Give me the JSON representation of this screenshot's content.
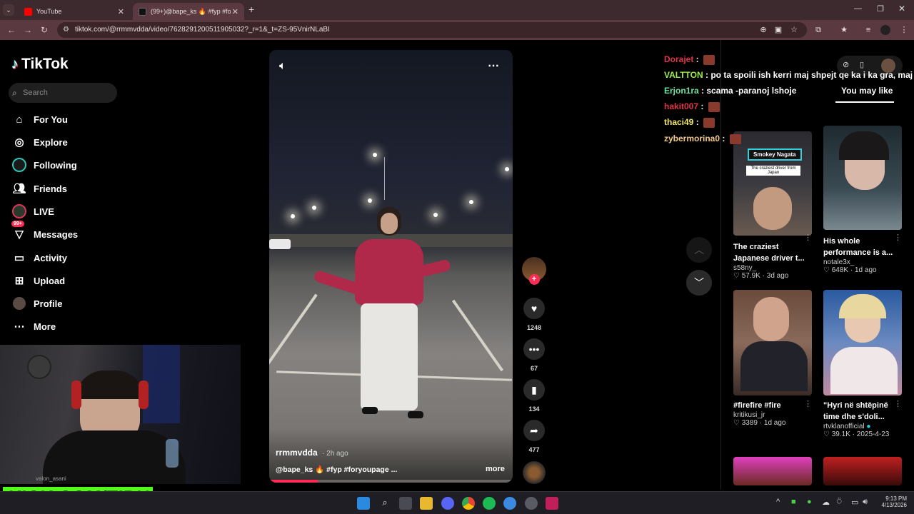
{
  "browser": {
    "tabs": [
      {
        "label": "YouTube",
        "icon": "youtube-icon"
      },
      {
        "label": "(99+)@bape_ks 🔥 #fyp #foryo",
        "icon": "tiktok-icon"
      }
    ],
    "new_tab": "+",
    "url": "tiktok.com/@rrmmvdda/video/7628291200511905032?_r=1&_t=ZS-95VnirNLaBI"
  },
  "sidebar": {
    "logo": "TikTok",
    "search_placeholder": "Search",
    "items": [
      {
        "label": "For You",
        "icon": "home-icon"
      },
      {
        "label": "Explore",
        "icon": "compass-icon"
      },
      {
        "label": "Following",
        "icon": "following-avatar-icon"
      },
      {
        "label": "Friends",
        "icon": "friends-icon"
      },
      {
        "label": "LIVE",
        "icon": "live-icon"
      },
      {
        "label": "Messages",
        "icon": "messages-icon",
        "badge": "99+"
      },
      {
        "label": "Activity",
        "icon": "activity-icon"
      },
      {
        "label": "Upload",
        "icon": "upload-icon"
      },
      {
        "label": "Profile",
        "icon": "profile-avatar-icon"
      },
      {
        "label": "More",
        "icon": "more-icon"
      }
    ]
  },
  "stream": {
    "webcam_caption": "valon_asani",
    "kick": "KICK.COM/TIBU"
  },
  "video": {
    "author": "rrmmvdda",
    "time": "· 2h ago",
    "caption": "@bape_ks 🔥 #fyp #foryoupage ...",
    "more": "more",
    "progress": 0.2
  },
  "actions": {
    "likes": "1248",
    "comments": "67",
    "saves": "134",
    "shares": "477"
  },
  "chat": [
    {
      "user": "Dorajet",
      "color": "#e0344a",
      "text": ""
    },
    {
      "user": "VALTTON",
      "color": "#9cf04a",
      "text": "po ta spoili ish kerri maj shpejt qe ka i ka gra, maj shpejt"
    },
    {
      "user": "Erjon1ra",
      "color": "#6fe2a0",
      "text": "scama -paranoj lshoje"
    },
    {
      "user": "hakit007",
      "color": "#e0344a",
      "text": ""
    },
    {
      "user": "thaci49",
      "color": "#f2e96a",
      "text": ""
    },
    {
      "user": "zybermorina0",
      "color": "#f2c98a",
      "text": ""
    }
  ],
  "feed": {
    "tab": "You may like",
    "cards": [
      {
        "title": "The craziest Japanese driver t...",
        "author": "s58ny_",
        "likes": "57.9K",
        "age": "3d ago",
        "overlay": "Smokey Nagata",
        "overlay2": "The craziest driver from Japan"
      },
      {
        "title": "His whole performance is a...",
        "author": "notale3x_",
        "likes": "648K",
        "age": "1d ago"
      },
      {
        "title": "#firefire #fire",
        "author": "kritikusi_jr",
        "likes": "3389",
        "age": "1d ago"
      },
      {
        "title": "\"Hyri në shtëpinë time dhe s'doli...",
        "author": "rtvklanofficial",
        "likes": "39.1K",
        "age": "2025-4-23"
      }
    ]
  },
  "taskbar": {
    "time": "9:13 PM",
    "date": "4/13/2026"
  },
  "colors": {
    "accent": "#fe2c55",
    "kick_green": "#53fc18"
  }
}
